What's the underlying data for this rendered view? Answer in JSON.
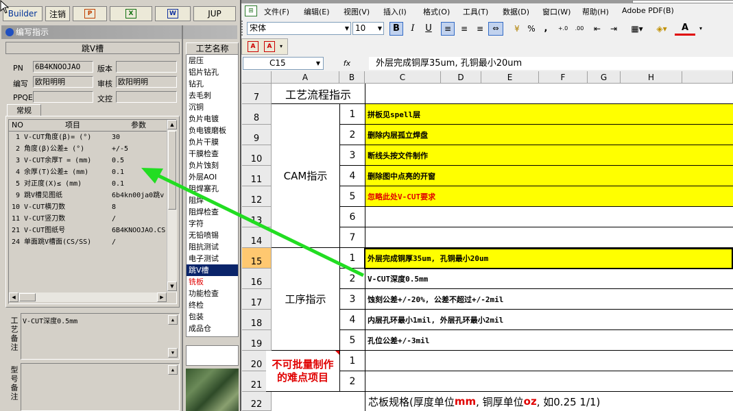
{
  "left_app": {
    "toolbar": {
      "builder": "Builder",
      "logout": "注销",
      "jup": "JUP",
      "icons": [
        "ppt-icon",
        "excel-icon",
        "word-icon"
      ]
    },
    "dialog_title": "编写指示",
    "section_title": "跳V槽",
    "fields": {
      "pn_label": "PN",
      "pn_value": "6B4KNOOJAO",
      "version_label": "版本",
      "version_value": "",
      "editor_label": "编写",
      "editor_value": "欧阳明明",
      "reviewer_label": "审核",
      "reviewer_value": "欧阳明明",
      "ppqe_label": "PPQE",
      "ppqe_value": "",
      "doc_control_label": "文控",
      "doc_control_value": ""
    },
    "tab_label": "常规",
    "grid": {
      "headers": [
        "NO",
        "项目",
        "参数"
      ],
      "rows": [
        {
          "no": "1",
          "item": "V-CUT角度(β)=  (°)",
          "param": "30"
        },
        {
          "no": "2",
          "item": "角度(β)公差±  (°)",
          "param": "+/-5"
        },
        {
          "no": "3",
          "item": "V-CUT余厚T =  (mm)",
          "param": "0.5"
        },
        {
          "no": "4",
          "item": "余厚(T)公差±  (mm)",
          "param": "0.1"
        },
        {
          "no": "5",
          "item": "对正度(X)≤  (mm)",
          "param": "0.1"
        },
        {
          "no": "9",
          "item": "跳V槽见图纸",
          "param": "6b4kn00ja0跳v"
        },
        {
          "no": "10",
          "item": "V-CUT横刀数",
          "param": "8"
        },
        {
          "no": "11",
          "item": "V-CUT竖刀数",
          "param": "/"
        },
        {
          "no": "21",
          "item": "V-CUT图纸号",
          "param": "6B4KNOOJAO.CS"
        },
        {
          "no": "24",
          "item": "单面跳V槽面(CS/SS)",
          "param": "/"
        }
      ]
    },
    "process_note_label": "工艺备注",
    "process_note_value": "V-CUT深度0.5mm",
    "model_note_label": "型号备注",
    "process_list_header": "工艺名称",
    "process_list": [
      "层压",
      "铝片钻孔",
      "钻孔",
      "去毛刺",
      "沉铜",
      "负片电镀",
      "负电镀磨板",
      "负片干膜",
      "干膜检查",
      "负片蚀刻",
      "外层AOI",
      "阻焊塞孔",
      "阻焊",
      "阻焊检查",
      "字符",
      "无铅喷锡",
      "阻抗测试",
      "电子测试",
      "跳V槽",
      "铣板",
      "功能检查",
      "终检",
      "包装",
      "成品仓"
    ],
    "selected_process": "跳V槽",
    "red_process": "铣板"
  },
  "excel": {
    "menu": [
      "文件(F)",
      "编辑(E)",
      "视图(V)",
      "插入(I)",
      "格式(O)",
      "工具(T)",
      "数据(D)",
      "窗口(W)",
      "帮助(H)",
      "Adobe PDF(B)"
    ],
    "font_name": "宋体",
    "font_size": "10",
    "name_box": "C15",
    "fx_label": "fx",
    "formula": "外层完成铜厚35um, 孔铜最小20um",
    "columns": [
      "A",
      "B",
      "C",
      "D",
      "E",
      "F",
      "G",
      "H"
    ],
    "row_numbers": [
      "7",
      "8",
      "9",
      "10",
      "11",
      "12",
      "13",
      "14",
      "15",
      "16",
      "17",
      "18",
      "19",
      "20",
      "21",
      "22"
    ],
    "header_title": "工艺流程指示",
    "cam_label": "CAM指示",
    "process_label": "工序指示",
    "difficult_label": "不可批量制作的难点项目",
    "cam_items": [
      {
        "no": "1",
        "text": "拼板见spell层",
        "highlight": true,
        "red": false
      },
      {
        "no": "2",
        "text": "删除内层孤立焊盘",
        "highlight": true,
        "red": false
      },
      {
        "no": "3",
        "text": "断线头按文件制作",
        "highlight": true,
        "red": false
      },
      {
        "no": "4",
        "text": "删除图中点亮的开窗",
        "highlight": true,
        "red": false
      },
      {
        "no": "5",
        "text": "忽略此处V-CUT要求",
        "highlight": true,
        "red": true
      },
      {
        "no": "6",
        "text": "",
        "highlight": false,
        "red": false
      },
      {
        "no": "7",
        "text": "",
        "highlight": false,
        "red": false
      }
    ],
    "process_items": [
      {
        "no": "1",
        "text": "外层完成铜厚35um, 孔铜最小20um",
        "highlight": true
      },
      {
        "no": "2",
        "text": "V-CUT深度0.5mm",
        "highlight": false
      },
      {
        "no": "3",
        "text": "蚀刻公差+/-20%, 公差不超过+/-2mil",
        "highlight": false
      },
      {
        "no": "4",
        "text": "内层孔环最小1mil, 外层孔环最小2mil",
        "highlight": false
      },
      {
        "no": "5",
        "text": "孔位公差+/-3mil",
        "highlight": false
      }
    ],
    "difficult_items": [
      {
        "no": "1",
        "text": ""
      },
      {
        "no": "2",
        "text": ""
      }
    ],
    "core_spec": {
      "prefix": "芯板规格(厚度单位",
      "unit1": "mm",
      "mid": ", 铜厚单位",
      "unit2": "oz",
      "suffix": ", 如0.25 1/1)"
    }
  },
  "colors": {
    "highlight_yellow": "#ffff00",
    "arrow_green": "#22dd22",
    "selected_blue": "#0a246a",
    "red_text": "#e00000"
  }
}
